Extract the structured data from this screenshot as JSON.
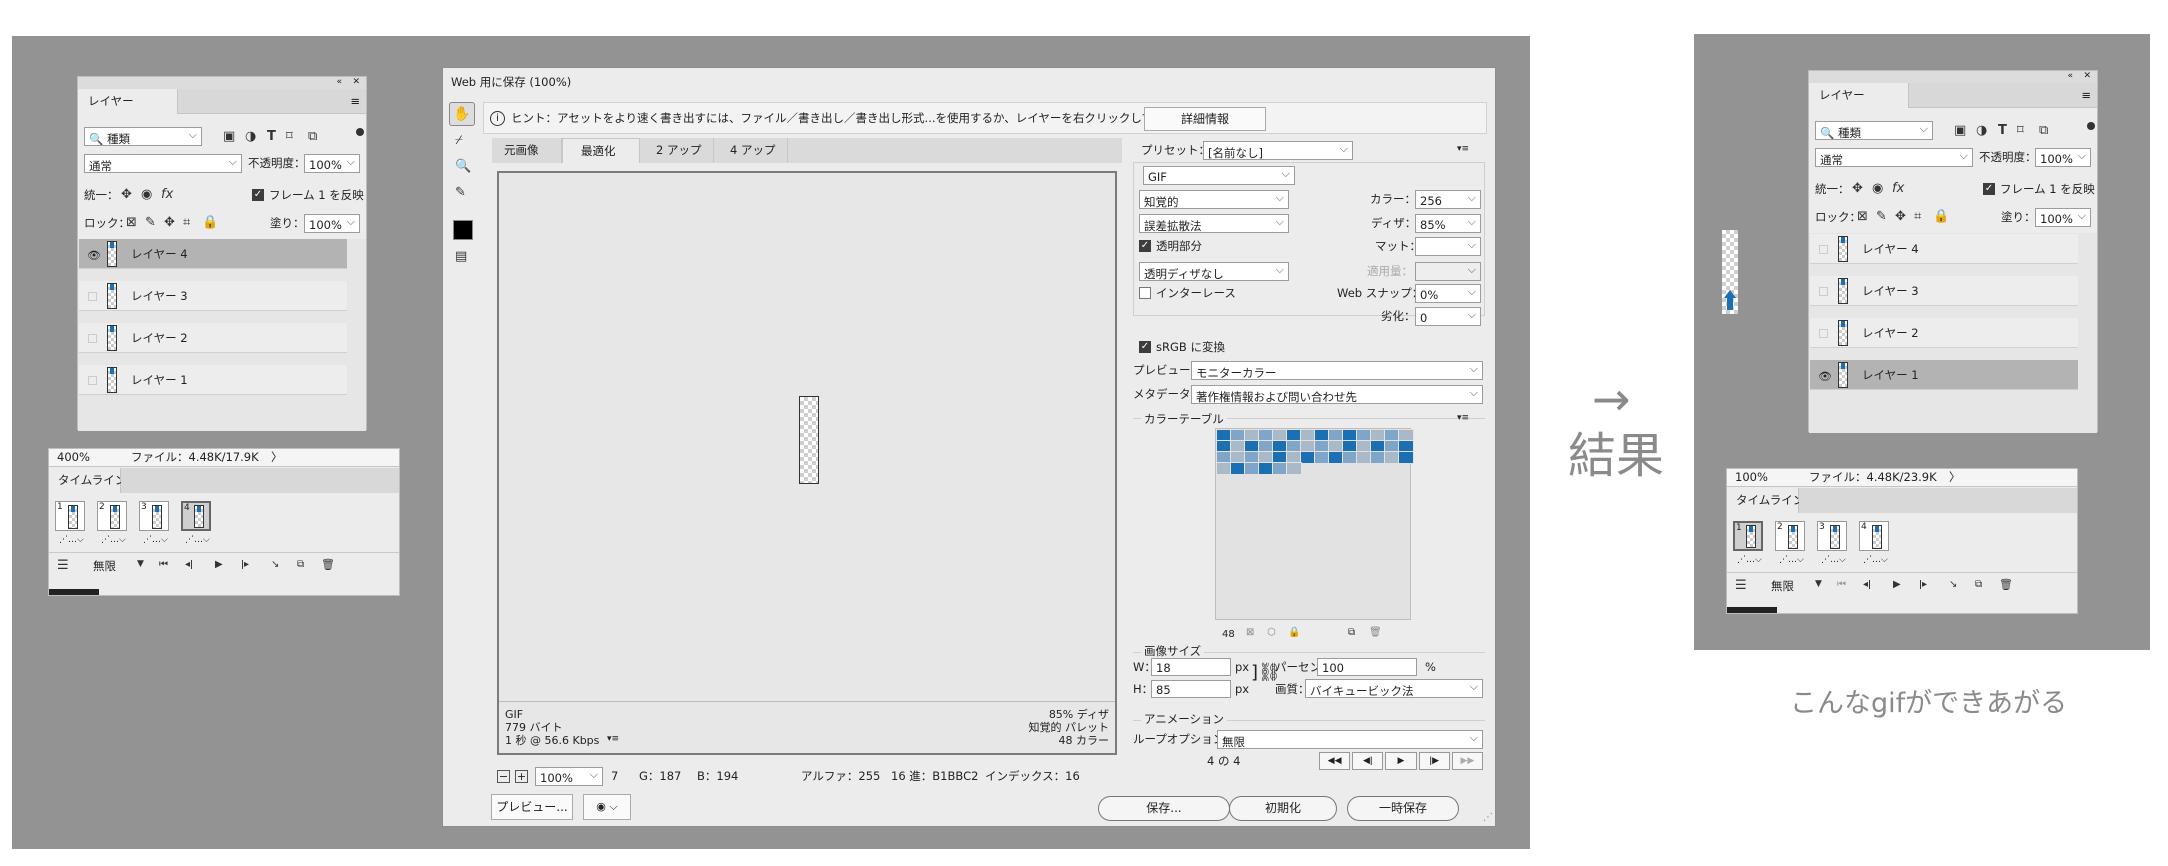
{
  "layers_panel": {
    "title": "レイヤー",
    "kind_filter": "種類",
    "blend_mode": "通常",
    "opacity_label": "不透明度：",
    "opacity_value": "100%",
    "unify_label": "統一：",
    "propagate_label": "フレーム 1 を反映",
    "lock_label": "ロック：",
    "fill_label": "塗り：",
    "fill_value": "100%",
    "layers": [
      "レイヤー 4",
      "レイヤー 3",
      "レイヤー 2",
      "レイヤー 1"
    ]
  },
  "left_status": {
    "zoom": "400%",
    "file": "ファイル：4.48K/17.9K",
    "arrow": "〉"
  },
  "left_timeline": {
    "title": "タイムライン",
    "frames": [
      "1",
      "2",
      "3",
      "4"
    ],
    "loop": "無限"
  },
  "save_for_web": {
    "title": "Web 用に保存 (100%)",
    "hint": "ヒント：アセットをより速く書き出すには、ファイル／書き出し／書き出し形式...を使用するか、レイヤーを右クリックして使用。",
    "more_info_button": "詳細情報",
    "tabs": [
      "元画像",
      "最適化",
      "2 アップ",
      "4 アップ"
    ],
    "active_tab": 1,
    "preview_info_left": [
      "GIF",
      "779 バイト",
      "1 秒 @ 56.6 Kbps"
    ],
    "preview_info_right": [
      "85% ディザ",
      "知覚的 パレット",
      "48 カラー"
    ],
    "preset_label": "プリセット：",
    "preset_value": "[名前なし]",
    "format": "GIF",
    "reduction": "知覚的",
    "dither_algo": "誤差拡散法",
    "colors_label": "カラー：",
    "colors_value": "256",
    "dither_label": "ディザ：",
    "dither_value": "85%",
    "transparency_label": "透明部分",
    "matte_label": "マット：",
    "trans_dither": "透明ディザなし",
    "amount_label": "適用量：",
    "interlace_label": "インターレース",
    "websnap_label": "Web スナップ：",
    "websnap_value": "0%",
    "lossy_label": "劣化：",
    "lossy_value": "0",
    "srgb_label": "sRGB に変換",
    "preview_label": "プレビュー：",
    "preview_value": "モニターカラー",
    "metadata_label": "メタデータ：",
    "metadata_value": "著作権情報および問い合わせ先",
    "color_table_title": "カラーテーブル",
    "color_count": "48",
    "image_size_title": "画像サイズ",
    "w_label": "W：",
    "w_value": "18",
    "h_label": "H：",
    "h_value": "85",
    "px": "px",
    "percent_label": "パーセント：",
    "percent_value": "100",
    "percent_unit": "%",
    "quality_label": "画質：",
    "quality_value": "バイキュービック法",
    "animation_title": "アニメーション",
    "loop_label": "ループオプション：",
    "loop_value": "無限",
    "frame_counter": "4 の 4",
    "status_zoom": "100%",
    "status_r": "7",
    "status_g": "G：187",
    "status_b": "B：194",
    "status_alpha": "アルファ：255",
    "status_hex": "16 進：B1BBC2",
    "status_index": "インデックス：16",
    "preview_button": "プレビュー...",
    "save_button": "保存...",
    "reset_button": "初期化",
    "done_button": "一時保存",
    "colors": {
      "blue": "#1b6fb3",
      "light_blue": "#7fa6c8",
      "gray_blue": "#a9b9c7"
    }
  },
  "arrow_text": "→",
  "result_text": "結果",
  "right_layers_panel": {
    "title": "レイヤー",
    "kind_filter": "種類",
    "blend_mode": "通常",
    "opacity_label": "不透明度：",
    "opacity_value": "100%",
    "unify_label": "統一：",
    "propagate_label": "フレーム 1 を反映",
    "lock_label": "ロック：",
    "fill_label": "塗り：",
    "fill_value": "100%",
    "layers": [
      "レイヤー 4",
      "レイヤー 3",
      "レイヤー 2",
      "レイヤー 1"
    ]
  },
  "right_status": {
    "zoom": "100%",
    "file": "ファイル：4.48K/23.9K",
    "arrow": "〉"
  },
  "right_timeline": {
    "title": "タイムライン",
    "frames": [
      "1",
      "2",
      "3",
      "4"
    ],
    "loop": "無限"
  },
  "caption": "こんなgifができあがる"
}
